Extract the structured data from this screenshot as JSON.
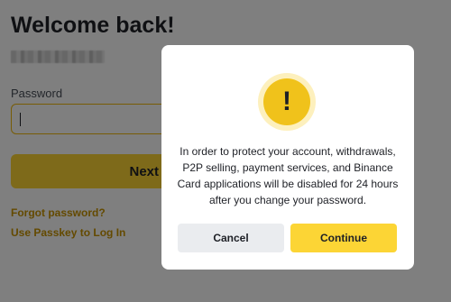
{
  "login": {
    "title": "Welcome back!",
    "password_label": "Password",
    "password_value": "",
    "next_label": "Next",
    "forgot_link": "Forgot password?",
    "passkey_link": "Use Passkey to Log In"
  },
  "dialog": {
    "icon": "exclamation-icon",
    "icon_glyph": "!",
    "message": "In order to protect your account, withdrawals, P2P selling, payment services, and Binance Card applications will be disabled for 24 hours after you change your password.",
    "cancel_label": "Cancel",
    "continue_label": "Continue"
  },
  "colors": {
    "accent": "#fcd535",
    "link": "#c99400",
    "overlay": "rgba(0,0,0,0.5)"
  }
}
